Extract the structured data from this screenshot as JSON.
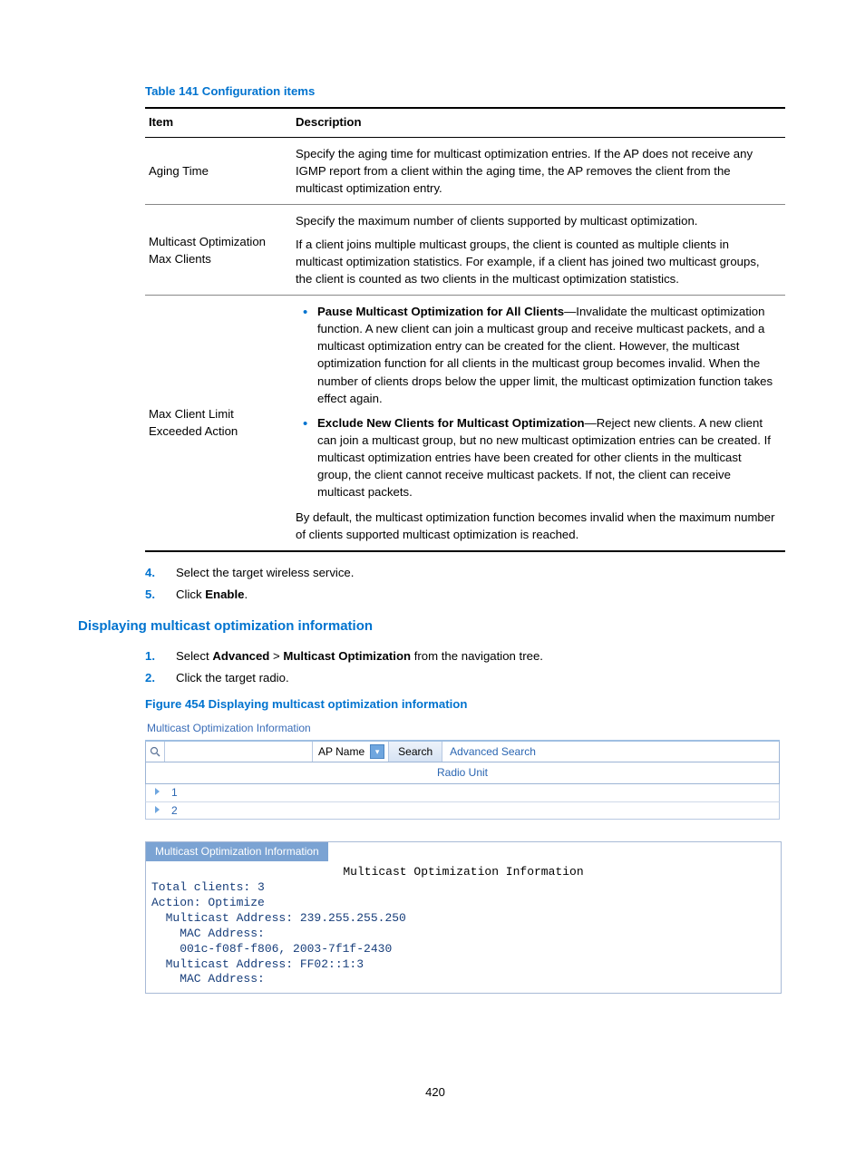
{
  "table": {
    "caption": "Table 141 Configuration items",
    "head_item": "Item",
    "head_desc": "Description",
    "rows": {
      "aging": {
        "item": "Aging Time",
        "desc": "Specify the aging time for multicast optimization entries. If the AP does not receive any IGMP report from a client within the aging time, the AP removes the client from the multicast optimization entry."
      },
      "maxclients": {
        "item": "Multicast Optimization Max Clients",
        "p1": "Specify the maximum number of clients supported by multicast optimization.",
        "p2": "If a client joins multiple multicast groups, the client is counted as multiple clients in multicast optimization statistics. For example, if a client has joined two multicast groups, the client is counted as two clients in the multicast optimization statistics."
      },
      "exceed": {
        "item": "Max Client Limit Exceeded Action",
        "b1_title": "Pause Multicast Optimization for All Clients",
        "b1_text": "—Invalidate the multicast optimization function. A new client can join a multicast group and receive multicast packets, and a multicast optimization entry can be created for the client. However, the multicast optimization function for all clients in the multicast group becomes invalid. When the number of clients drops below the upper limit, the multicast optimization function takes effect again.",
        "b2_title": "Exclude New Clients for Multicast Optimization",
        "b2_text": "—Reject new clients. A new client can join a multicast group, but no new multicast optimization entries can be created. If multicast optimization entries have been created for other clients in the multicast group, the client cannot receive multicast packets. If not, the client can receive multicast packets.",
        "pend": "By default, the multicast optimization function becomes invalid when the maximum number of clients supported multicast optimization is reached."
      }
    }
  },
  "steps1": {
    "n4": "4.",
    "t4": "Select the target wireless service.",
    "n5": "5.",
    "t5_pre": "Click ",
    "t5_b": "Enable",
    "t5_post": "."
  },
  "heading2": "Displaying multicast optimization information",
  "steps2": {
    "n1": "1.",
    "t1_pre": "Select ",
    "t1_b1": "Advanced",
    "t1_mid": " > ",
    "t1_b2": "Multicast Optimization",
    "t1_post": " from the navigation tree.",
    "n2": "2.",
    "t2": "Click the target radio."
  },
  "figure_caption": "Figure 454 Displaying multicast optimization information",
  "ui": {
    "title": "Multicast Optimization Information",
    "search_placeholder": "",
    "select_label": "AP Name",
    "search_btn": "Search",
    "adv_search": "Advanced Search",
    "radio_header": "Radio Unit",
    "row1": "1",
    "row2": "2"
  },
  "info": {
    "tab": "Multicast Optimization Information",
    "line_center": "Multicast Optimization Information",
    "l1": "Total clients: 3",
    "l2": "Action: Optimize",
    "l3": "  Multicast Address: 239.255.255.250",
    "l4": "    MAC Address:",
    "l5": "    001c-f08f-f806, 2003-7f1f-2430",
    "l6": "  Multicast Address: FF02::1:3",
    "l7": "    MAC Address:"
  },
  "page_number": "420"
}
